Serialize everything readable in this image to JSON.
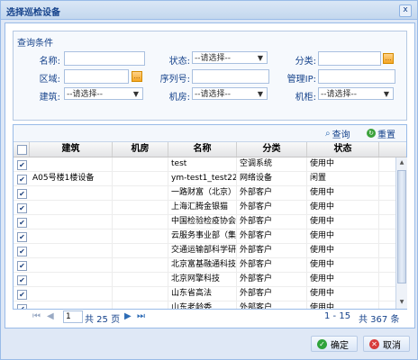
{
  "window": {
    "title": "选择巡检设备",
    "close": "x"
  },
  "filter": {
    "legend": "查询条件",
    "fields": {
      "name_label": "名称:",
      "status_label": "状态:",
      "status_value": "--请选择--",
      "category_label": "分类:",
      "area_label": "区域:",
      "serial_label": "序列号:",
      "mgmt_ip_label": "管理IP:",
      "building_label": "建筑:",
      "building_value": "--请选择--",
      "room_label": "机房:",
      "room_value": "--请选择--",
      "cabinet_label": "机柜:",
      "cabinet_value": "--请选择--"
    }
  },
  "toolbar": {
    "query": "查询",
    "reset": "重置"
  },
  "table": {
    "columns": [
      "建筑",
      "机房",
      "名称",
      "分类",
      "状态"
    ],
    "rows": [
      {
        "checked": true,
        "building": "",
        "room": "",
        "name": "test",
        "category": "空调系统",
        "status": "使用中"
      },
      {
        "checked": true,
        "building": "A05号楼1楼设备",
        "room": "",
        "name": "ym-test1_test22",
        "category": "网络设备",
        "status": "闲置"
      },
      {
        "checked": true,
        "building": "",
        "room": "",
        "name": "一路财富（北京）",
        "category": "外部客户",
        "status": "使用中"
      },
      {
        "checked": true,
        "building": "",
        "room": "",
        "name": "上海汇腾金银猫",
        "category": "外部客户",
        "status": "使用中"
      },
      {
        "checked": true,
        "building": "",
        "room": "",
        "name": "中国检验检疫协会",
        "category": "外部客户",
        "status": "使用中"
      },
      {
        "checked": true,
        "building": "",
        "room": "",
        "name": "云服务事业部（集",
        "category": "外部客户",
        "status": "使用中"
      },
      {
        "checked": true,
        "building": "",
        "room": "",
        "name": "交通运输部科学研",
        "category": "外部客户",
        "status": "使用中"
      },
      {
        "checked": true,
        "building": "",
        "room": "",
        "name": "北京富基融通科技",
        "category": "外部客户",
        "status": "使用中"
      },
      {
        "checked": true,
        "building": "",
        "room": "",
        "name": "北京网擎科技",
        "category": "外部客户",
        "status": "使用中"
      },
      {
        "checked": true,
        "building": "",
        "room": "",
        "name": "山东省高法",
        "category": "外部客户",
        "status": "使用中"
      },
      {
        "checked": true,
        "building": "",
        "room": "",
        "name": "山东老龄委",
        "category": "外部客户",
        "status": "使用中"
      }
    ]
  },
  "pager": {
    "page": "1",
    "total_pages": "共 25 页",
    "range": "1 - 15",
    "total_records": "共 367 条"
  },
  "buttons": {
    "ok": "确定",
    "cancel": "取消"
  },
  "colors": {
    "header_bg": "#dae7f6",
    "border": "#99bbe8",
    "accent": "#15428b"
  }
}
